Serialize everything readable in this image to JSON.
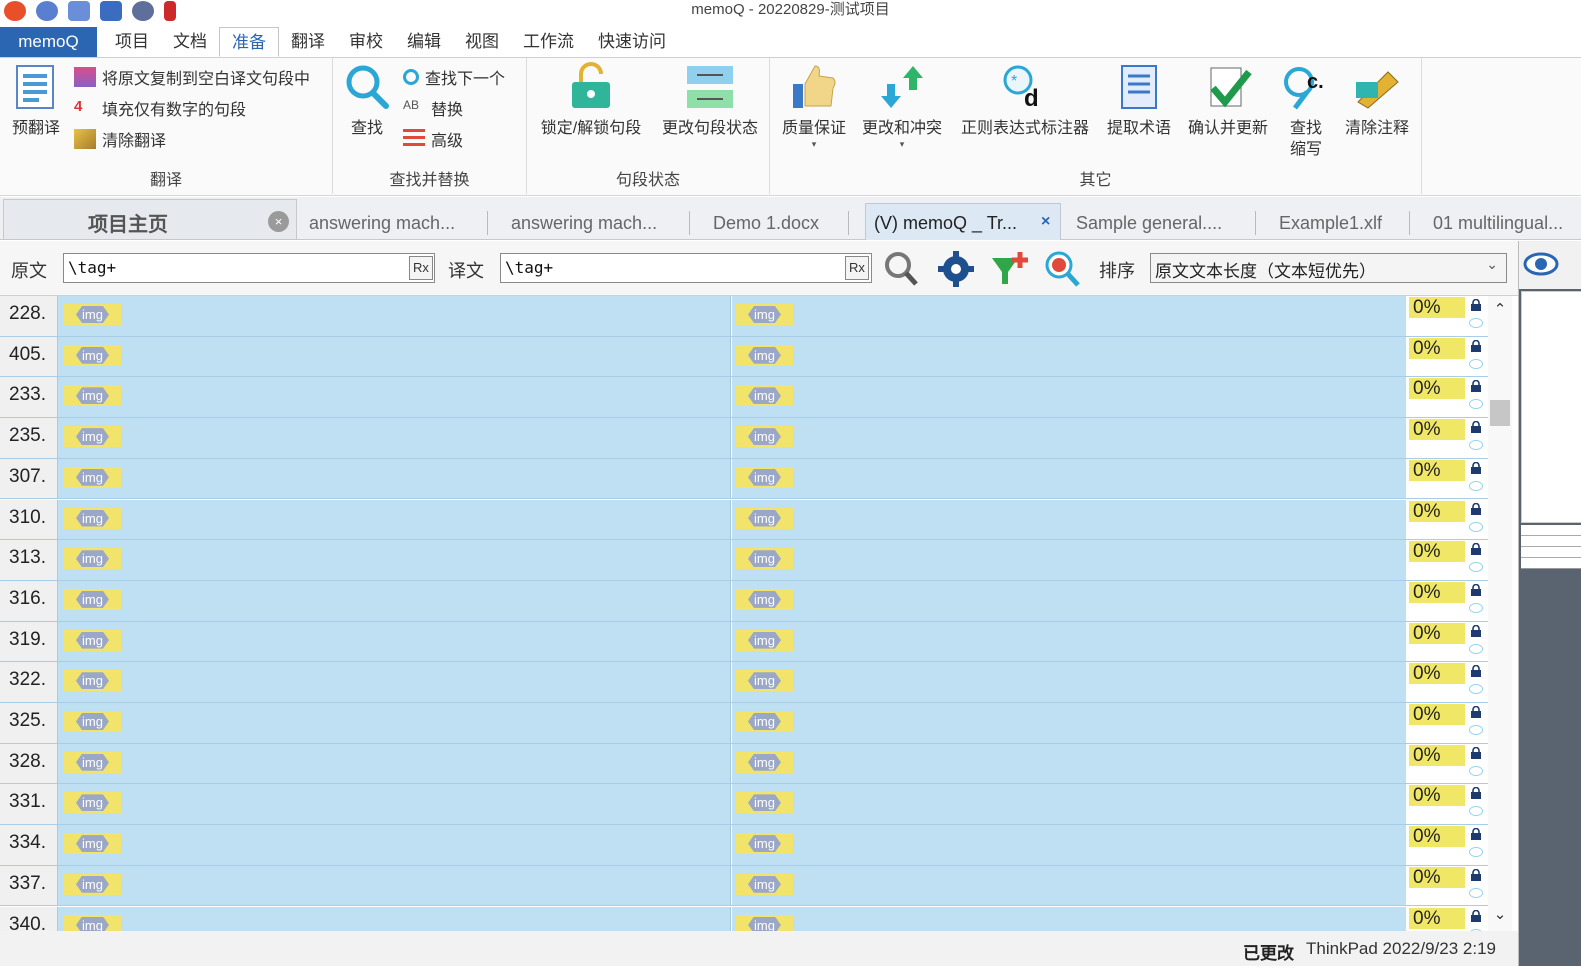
{
  "window": {
    "title": "memoQ - 20220829-测试项目"
  },
  "ribbon_tabs": [
    {
      "label": "memoQ"
    },
    {
      "label": "项目"
    },
    {
      "label": "文档"
    },
    {
      "label": "准备"
    },
    {
      "label": "翻译"
    },
    {
      "label": "审校"
    },
    {
      "label": "编辑"
    },
    {
      "label": "视图"
    },
    {
      "label": "工作流"
    },
    {
      "label": "快速访问"
    }
  ],
  "ribbon": {
    "translate_group": {
      "label": "翻译",
      "pretranslate": "预翻译",
      "copy_source": "将原文复制到空白译文句段中",
      "fill_numbers": "填充仅有数字的句段",
      "clear_translation": "清除翻译"
    },
    "find_group": {
      "label": "查找并替换",
      "find": "查找",
      "find_next": "查找下一个",
      "replace": "替换",
      "advanced": "高级"
    },
    "segment_group": {
      "label": "句段状态",
      "lock": "锁定/解锁句段",
      "change_status": "更改句段状态"
    },
    "other_group": {
      "label": "其它",
      "qa": "质量保证",
      "changes_conflicts": "更改和冲突",
      "regex_tagger": "正则表达式标注器",
      "extract_terms": "提取术语",
      "confirm_update": "确认并更新",
      "find_abbrev_line1": "查找",
      "find_abbrev_line2": "缩写",
      "clear_comments": "清除注释"
    }
  },
  "doc_tabs": {
    "home": "项目主页",
    "tabs": [
      "answering mach...",
      "answering mach...",
      "Demo 1.docx"
    ],
    "active": "(V) memoQ _ Tr...",
    "more": [
      "Sample general....",
      "Example1.xlf",
      "01 multilingual..."
    ]
  },
  "filter": {
    "source_label": "原文",
    "source_value": "\\tag+",
    "target_label": "译文",
    "target_value": "\\tag+",
    "rx": "Rx",
    "sort_label": "排序",
    "sort_value": "原文文本长度（文本短优先）"
  },
  "rows": [
    {
      "num": "228.",
      "src_tag": "img",
      "tgt_tag": "img",
      "match": "0%"
    },
    {
      "num": "405.",
      "src_tag": "img",
      "tgt_tag": "img",
      "match": "0%"
    },
    {
      "num": "233.",
      "src_tag": "img",
      "tgt_tag": "img",
      "match": "0%"
    },
    {
      "num": "235.",
      "src_tag": "img",
      "tgt_tag": "img",
      "match": "0%"
    },
    {
      "num": "307.",
      "src_tag": "img",
      "tgt_tag": "img",
      "match": "0%"
    },
    {
      "num": "310.",
      "src_tag": "img",
      "tgt_tag": "img",
      "match": "0%"
    },
    {
      "num": "313.",
      "src_tag": "img",
      "tgt_tag": "img",
      "match": "0%"
    },
    {
      "num": "316.",
      "src_tag": "img",
      "tgt_tag": "img",
      "match": "0%"
    },
    {
      "num": "319.",
      "src_tag": "img",
      "tgt_tag": "img",
      "match": "0%"
    },
    {
      "num": "322.",
      "src_tag": "img",
      "tgt_tag": "img",
      "match": "0%"
    },
    {
      "num": "325.",
      "src_tag": "img",
      "tgt_tag": "img",
      "match": "0%"
    },
    {
      "num": "328.",
      "src_tag": "img",
      "tgt_tag": "img",
      "match": "0%"
    },
    {
      "num": "331.",
      "src_tag": "img",
      "tgt_tag": "img",
      "match": "0%"
    },
    {
      "num": "334.",
      "src_tag": "img",
      "tgt_tag": "img",
      "match": "0%"
    },
    {
      "num": "337.",
      "src_tag": "img",
      "tgt_tag": "img",
      "match": "0%"
    },
    {
      "num": "340.",
      "src_tag": "img",
      "tgt_tag": "img",
      "match": "0%"
    }
  ],
  "status": {
    "changed": "已更改",
    "user_time": "ThinkPad 2022/9/23 2:19"
  },
  "colors": {
    "accent": "#2b66b3",
    "segment_bg": "#bfe0f3",
    "match_bg": "#f1e766",
    "tag_bg": "#9aa7c7"
  },
  "icons": {
    "scroll_up": "⌃",
    "scroll_down": "⌄",
    "close": "×"
  }
}
